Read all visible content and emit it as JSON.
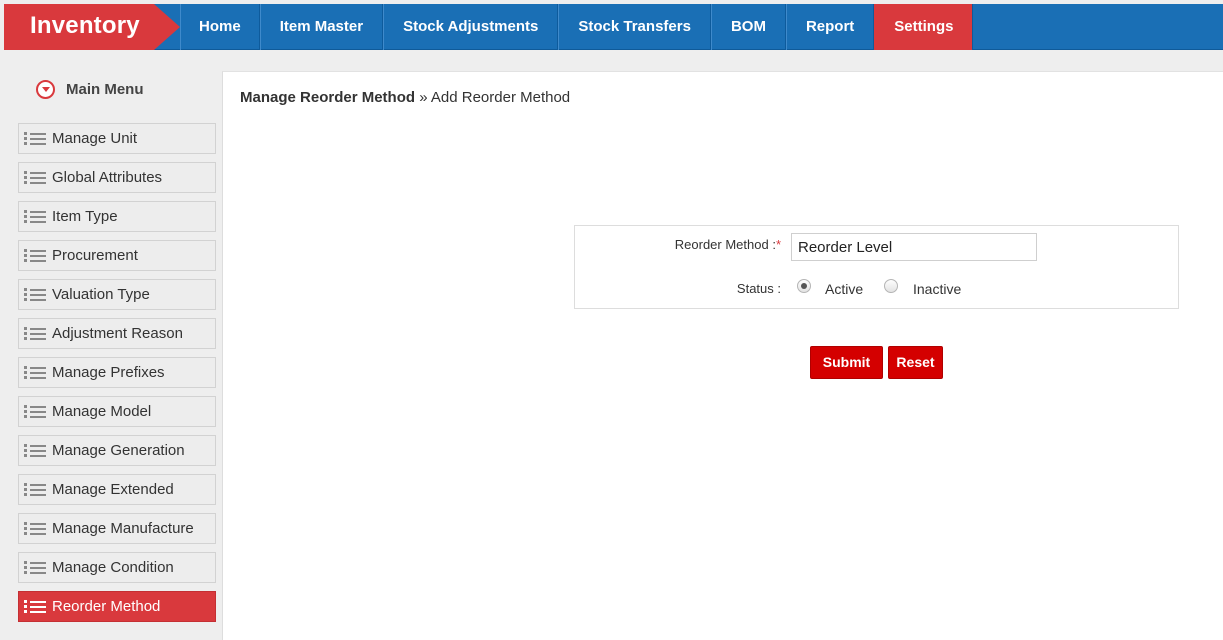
{
  "app": {
    "title": "Inventory"
  },
  "nav": {
    "items": [
      "Home",
      "Item Master",
      "Stock Adjustments",
      "Stock Transfers",
      "BOM",
      "Report",
      "Settings"
    ],
    "active": "Settings"
  },
  "sidebar": {
    "heading": "Main Menu",
    "items": [
      "Manage Unit",
      "Global Attributes",
      "Item Type",
      "Procurement",
      "Valuation Type",
      "Adjustment Reason",
      "Manage Prefixes",
      "Manage Model",
      "Manage Generation",
      "Manage Extended",
      "Manage Manufacture",
      "Manage Condition",
      "Reorder Method"
    ],
    "active": "Reorder Method"
  },
  "breadcrumb": {
    "parent": "Manage Reorder Method",
    "separator": "»",
    "current": "Add Reorder Method"
  },
  "form": {
    "reorder_label": "Reorder Method :",
    "required_mark": "*",
    "reorder_value": "Reorder Level",
    "status_label": "Status :",
    "status_options": [
      "Active",
      "Inactive"
    ],
    "status_selected": "Active",
    "submit_label": "Submit",
    "reset_label": "Reset"
  },
  "colors": {
    "brand_red": "#d9393d",
    "nav_blue": "#1a6fb5",
    "button_red": "#d40000"
  }
}
